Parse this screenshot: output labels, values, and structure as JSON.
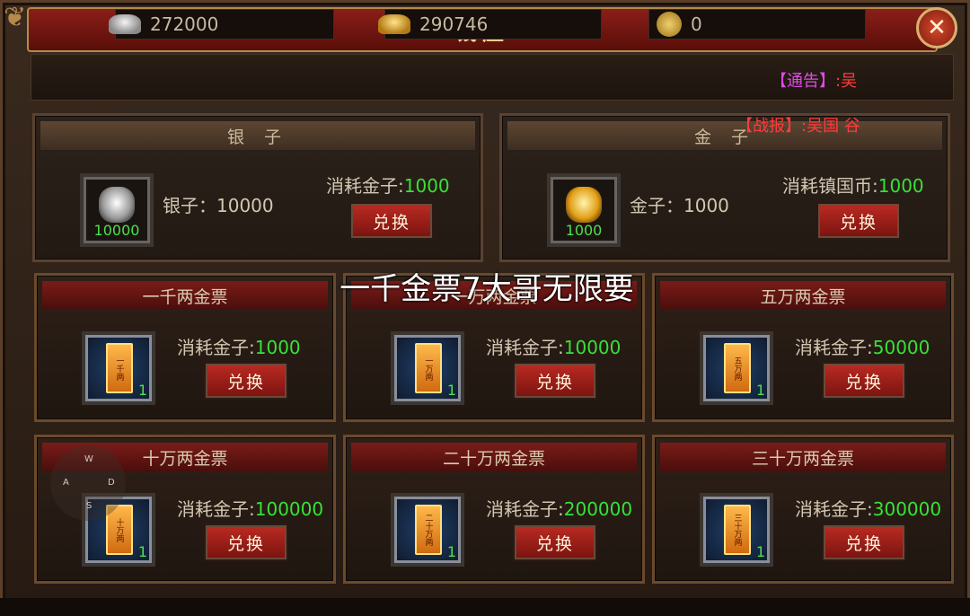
{
  "title": "钱庄",
  "close_label": "✕",
  "currencies": [
    {
      "name": "silver",
      "value": "272000"
    },
    {
      "name": "gold",
      "value": "290746"
    },
    {
      "name": "coin",
      "value": "0"
    }
  ],
  "notices": {
    "notice_tag": "【通告】",
    "notice_text": ":吴",
    "battle_tag": "【战报】",
    "battle_text": ":吴国 谷"
  },
  "top_panels": [
    {
      "title": "银 子",
      "item_label": "银子：10000",
      "count": "10000",
      "cost_label": "消耗金子:",
      "cost_value": "1000",
      "button": "兑换"
    },
    {
      "title": "金 子",
      "item_label": "金子：1000",
      "count": "1000",
      "cost_label": "消耗镇国币:",
      "cost_value": "1000",
      "button": "兑换"
    }
  ],
  "cards": [
    {
      "title": "一千两金票",
      "ticket": "一千两",
      "count": "1",
      "cost_label": "消耗金子:",
      "cost_value": "1000",
      "button": "兑换"
    },
    {
      "title": "一万两金票",
      "ticket": "一万两",
      "count": "1",
      "cost_label": "消耗金子:",
      "cost_value": "10000",
      "button": "兑换"
    },
    {
      "title": "五万两金票",
      "ticket": "五万两",
      "count": "1",
      "cost_label": "消耗金子:",
      "cost_value": "50000",
      "button": "兑换"
    },
    {
      "title": "十万两金票",
      "ticket": "十万两",
      "count": "1",
      "cost_label": "消耗金子:",
      "cost_value": "100000",
      "button": "兑换"
    },
    {
      "title": "二十万两金票",
      "ticket": "二十万两",
      "count": "1",
      "cost_label": "消耗金子:",
      "cost_value": "200000",
      "button": "兑换"
    },
    {
      "title": "三十万两金票",
      "ticket": "三十万两",
      "count": "1",
      "cost_label": "消耗金子:",
      "cost_value": "300000",
      "button": "兑换"
    }
  ],
  "overlay_caption": "一千金票7大哥无限要",
  "joystick": {
    "w": "W",
    "a": "A",
    "d": "D",
    "s": "S"
  }
}
